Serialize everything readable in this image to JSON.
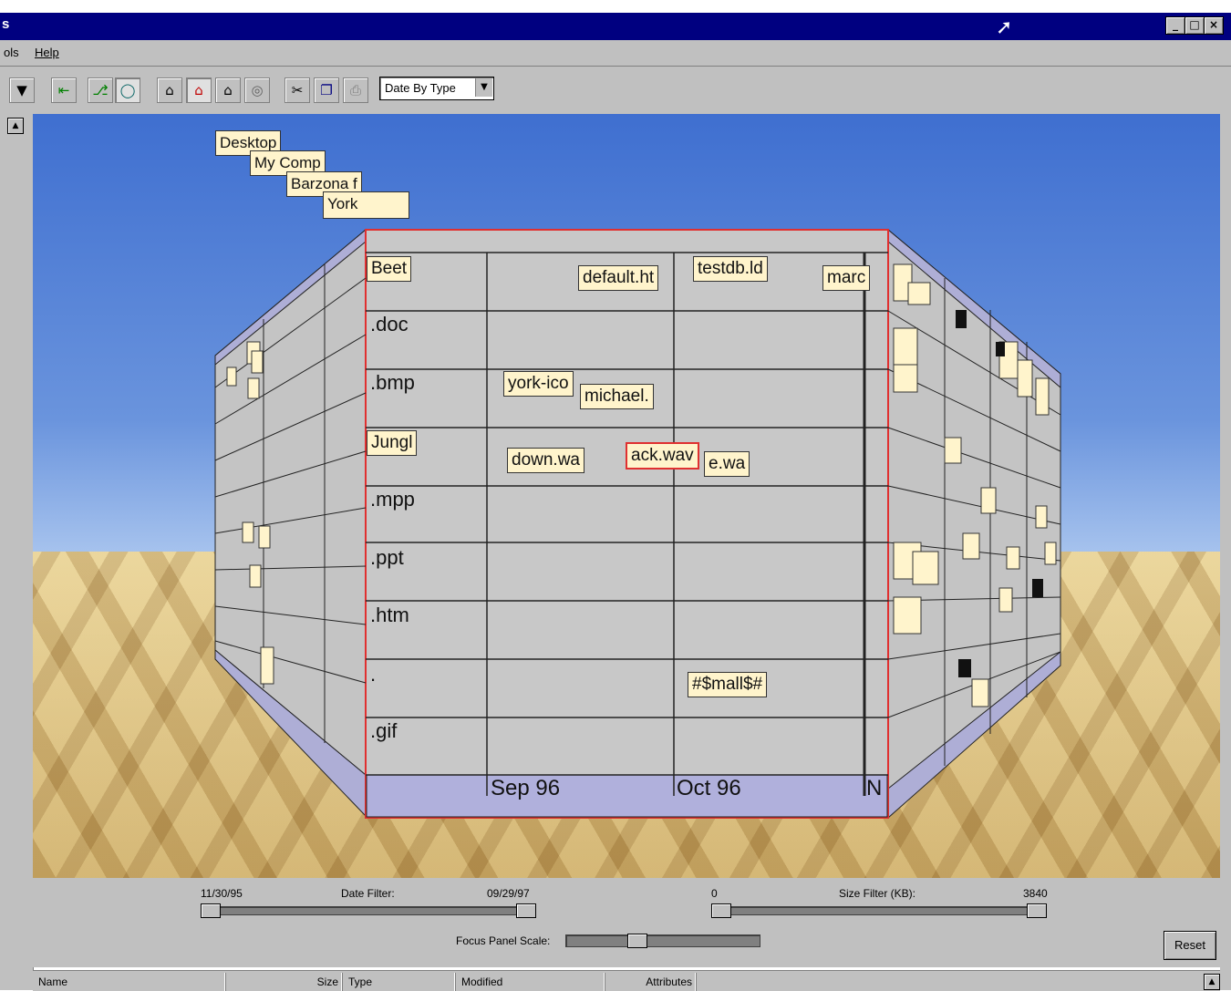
{
  "window": {
    "title": "",
    "title_fragment": "s",
    "buttons": [
      "_",
      "□",
      "×"
    ]
  },
  "menu": {
    "items": [
      "ols",
      "Help"
    ]
  },
  "toolbar": {
    "view_select": "Date By Type"
  },
  "scene": {
    "hierarchy_path": [
      "Desktop",
      "My Comp",
      "Barzona f",
      "York"
    ],
    "row_labels": [
      "Beet",
      ".doc",
      ".bmp",
      "Jungl",
      ".mpp",
      ".ppt",
      ".htm",
      ".",
      ".gif"
    ],
    "column_labels": [
      "Sep 96",
      "Oct 96",
      "N"
    ],
    "files": [
      {
        "name": "default.ht"
      },
      {
        "name": "testdb.ld"
      },
      {
        "name": "marc"
      },
      {
        "name": "york-ico"
      },
      {
        "name": "michael."
      },
      {
        "name": "down.wa"
      },
      {
        "name": "ack.wav",
        "selected": true
      },
      {
        "name": "e.wa"
      },
      {
        "name": "#$mall$#"
      }
    ],
    "colors": {
      "sky": "#4a78d4",
      "wall": "#c8c8c8",
      "floor_band": "#b0b0dc",
      "selection": "#e03030",
      "label_bg": "#fff4cc"
    }
  },
  "filters": {
    "date_filter_label": "Date Filter:",
    "date_min": "11/30/95",
    "date_max": "09/29/97",
    "size_filter_label": "Size Filter (KB):",
    "size_min": "0",
    "size_max": "3840",
    "focus_panel_label": "Focus Panel Scale:",
    "reset_label": "Reset"
  },
  "file_list": {
    "columns": [
      "Name",
      "Size",
      "Type",
      "Modified",
      "Attributes"
    ]
  }
}
